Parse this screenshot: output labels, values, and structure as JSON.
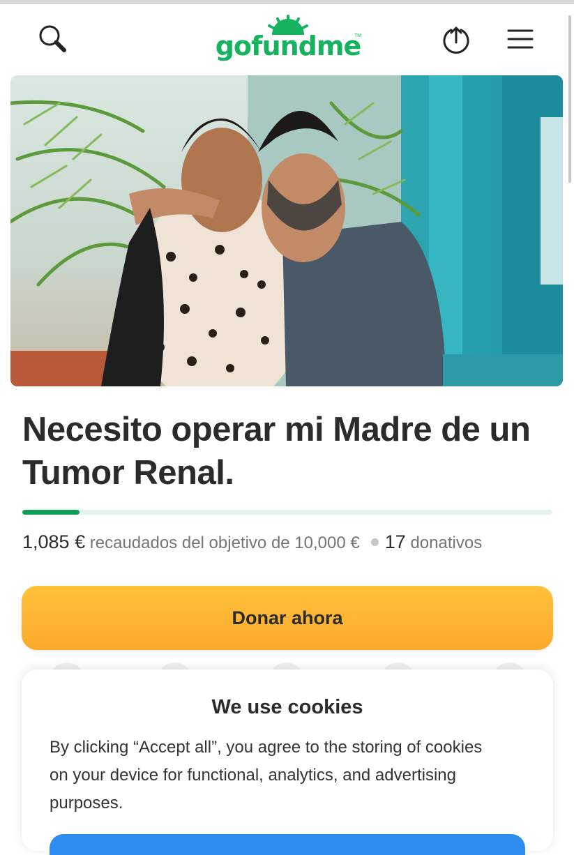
{
  "header": {
    "logo_text": "gofundme",
    "logo_tm": "TM",
    "icons": {
      "search": "search-icon",
      "share": "share-icon",
      "menu": "menu-icon"
    }
  },
  "campaign": {
    "title": "Necesito operar mi Madre de un Tumor Renal.",
    "raised": "1,085 €",
    "goal_text": "recaudados del objetivo de 10,000 €",
    "donations_count": "17",
    "donations_label": "donativos",
    "progress_fraction": 0.1085,
    "donate_label": "Donar ahora"
  },
  "cookies": {
    "title": "We use cookies",
    "text": "By clicking “Accept all”, you agree to the storing of cookies on your device for functional, analytics, and advertising purposes."
  },
  "colors": {
    "brand_green": "#16b35f",
    "progress": "#0f9f57",
    "donate_button": "#fcae30",
    "accept_button": "#2f8cf0"
  }
}
